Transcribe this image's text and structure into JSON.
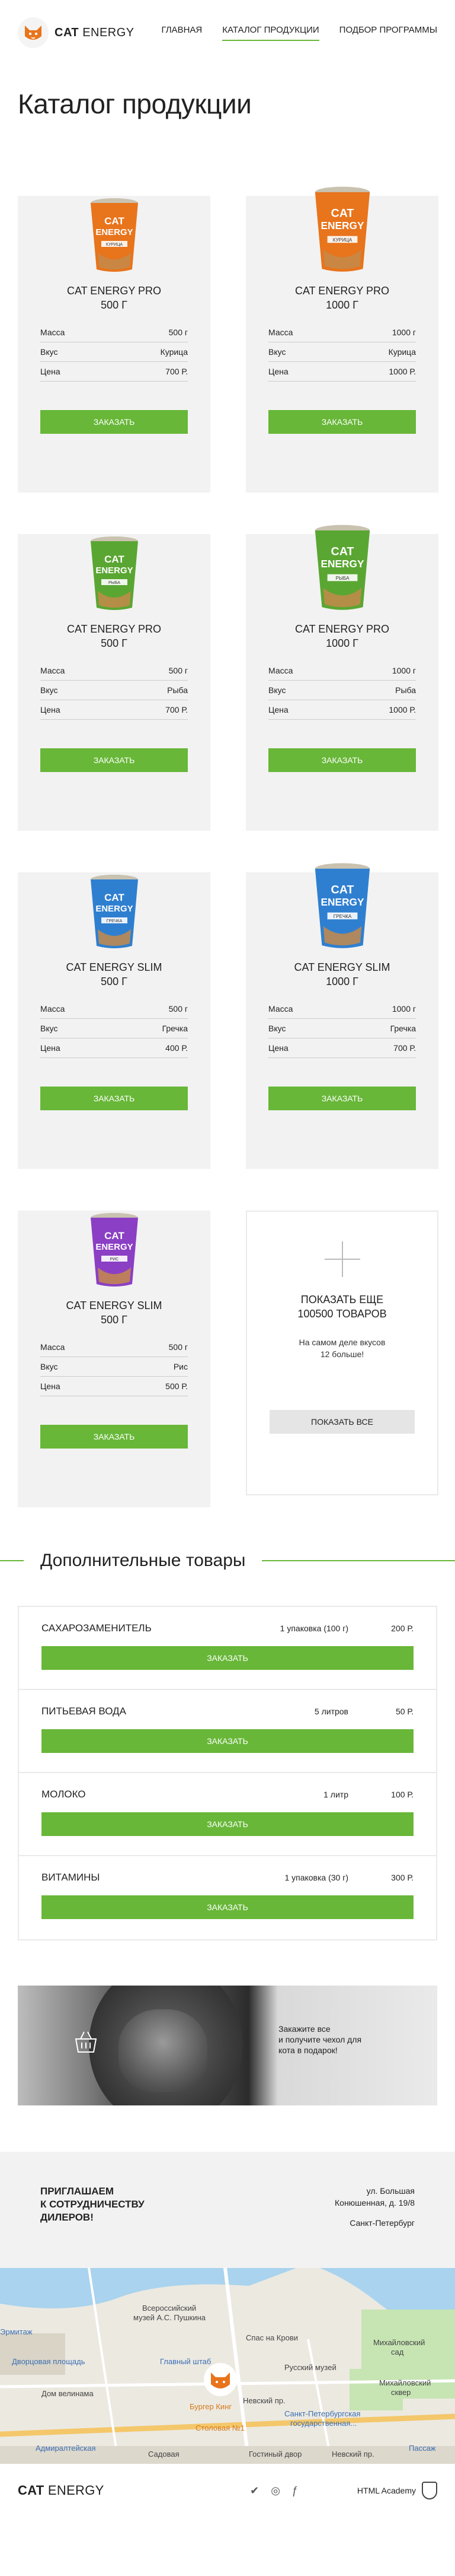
{
  "header": {
    "logo_bold": "CAT",
    "logo_light": "ENERGY",
    "nav": [
      "ГЛАВНАЯ",
      "КАТАЛОГ ПРОДУКЦИИ",
      "ПОДБОР ПРОГРАММЫ"
    ]
  },
  "page_title": "Каталог продукции",
  "products": [
    {
      "title_line1": "CAT ENERGY PRO",
      "title_line2": "500 г",
      "mass_label": "Масса",
      "mass": "500 г",
      "taste_label": "Вкус",
      "taste": "Курица",
      "price_label": "Цена",
      "price": "700 Р.",
      "button": "ЗАКАЗАТЬ",
      "pack_color": "#e8741c",
      "pack_tag": "КУРИЦА"
    },
    {
      "title_line1": "CAT ENERGY PRO",
      "title_line2": "1000 г",
      "mass_label": "Масса",
      "mass": "1000 г",
      "taste_label": "Вкус",
      "taste": "Курица",
      "price_label": "Цена",
      "price": "1000 Р.",
      "button": "ЗАКАЗАТЬ",
      "pack_color": "#e8741c",
      "pack_tag": "КУРИЦА"
    },
    {
      "title_line1": "CAT ENERGY PRO",
      "title_line2": "500 г",
      "mass_label": "Масса",
      "mass": "500 г",
      "taste_label": "Вкус",
      "taste": "Рыба",
      "price_label": "Цена",
      "price": "700 Р.",
      "button": "ЗАКАЗАТЬ",
      "pack_color": "#5aa632",
      "pack_tag": "РЫБА"
    },
    {
      "title_line1": "CAT ENERGY PRO",
      "title_line2": "1000 г",
      "mass_label": "Масса",
      "mass": "1000 г",
      "taste_label": "Вкус",
      "taste": "Рыба",
      "price_label": "Цена",
      "price": "1000 Р.",
      "button": "ЗАКАЗАТЬ",
      "pack_color": "#5aa632",
      "pack_tag": "РЫБА"
    },
    {
      "title_line1": "CAT ENERGY SLIM",
      "title_line2": "500 г",
      "mass_label": "Масса",
      "mass": "500 г",
      "taste_label": "Вкус",
      "taste": "Гречка",
      "price_label": "Цена",
      "price": "400 Р.",
      "button": "ЗАКАЗАТЬ",
      "pack_color": "#2f7fd0",
      "pack_tag": "ГРЕЧКА"
    },
    {
      "title_line1": "CAT ENERGY SLIM",
      "title_line2": "1000 г",
      "mass_label": "Масса",
      "mass": "1000 г",
      "taste_label": "Вкус",
      "taste": "Гречка",
      "price_label": "Цена",
      "price": "700 Р.",
      "button": "ЗАКАЗАТЬ",
      "pack_color": "#2f7fd0",
      "pack_tag": "ГРЕЧКА"
    },
    {
      "title_line1": "CAT ENERGY SLIM",
      "title_line2": "500 г",
      "mass_label": "Масса",
      "mass": "500 г",
      "taste_label": "Вкус",
      "taste": "Рис",
      "price_label": "Цена",
      "price": "500 Р.",
      "button": "ЗАКАЗАТЬ",
      "pack_color": "#8b3fc4",
      "pack_tag": "РИС"
    }
  ],
  "more": {
    "title_line1": "ПОКАЗАТЬ ЕЩЕ",
    "title_line2": "100500 ТОВАРОВ",
    "text_line1": "На самом деле вкусов",
    "text_line2": "12 больше!",
    "button": "ПОКАЗАТЬ ВСЕ"
  },
  "extras_title": "Дополнительные товары",
  "extras": [
    {
      "name": "САХАРОЗАМЕНИТЕЛЬ",
      "pack": "1 упаковка (100 г)",
      "price": "200 Р.",
      "button": "ЗАКАЗАТЬ"
    },
    {
      "name": "ПИТЬЕВАЯ ВОДА",
      "pack": "5 литров",
      "price": "50 Р.",
      "button": "ЗАКАЗАТЬ"
    },
    {
      "name": "МОЛОКО",
      "pack": "1 литр",
      "price": "100 Р.",
      "button": "ЗАКАЗАТЬ"
    },
    {
      "name": "ВИТАМИНЫ",
      "pack": "1 упаковка (30 г)",
      "price": "300 Р.",
      "button": "ЗАКАЗАТЬ"
    }
  ],
  "promo": {
    "line1": "Закажите все",
    "line2": "и получите чехол для",
    "line3": "кота в подарок!"
  },
  "dealers": {
    "title_line1": "ПРИГЛАШАЕМ",
    "title_line2": "К СОТРУДНИЧЕСТВУ",
    "title_line3": "ДИЛЕРОВ!",
    "addr_line1": "ул. Большая",
    "addr_line2": "Конюшенная, д. 19/8",
    "city": "Санкт-Петербург"
  },
  "map": {
    "labels": [
      "Всероссийский",
      "музей А.С. Пушкина",
      "Спас на Крови",
      "Михайловский",
      "сад",
      "Главный штаб",
      "Русский музей",
      "Михайловский",
      "сквер",
      "Дворцовая площадь",
      "Эрмитаж",
      "Дом велинама",
      "Бургер Кинг",
      "Невский пр.",
      "Санкт-Петербургская",
      "государственная...",
      "Столовая №1",
      "Адмиралтейская",
      "Пассаж",
      "Гостиный двор",
      "Невский пр.",
      "Садовая"
    ]
  },
  "footer": {
    "logo_bold": "CAT",
    "logo_light": "ENERGY",
    "socials": [
      "vk-icon",
      "instagram-icon",
      "facebook-icon"
    ],
    "academy": "HTML Academy"
  }
}
